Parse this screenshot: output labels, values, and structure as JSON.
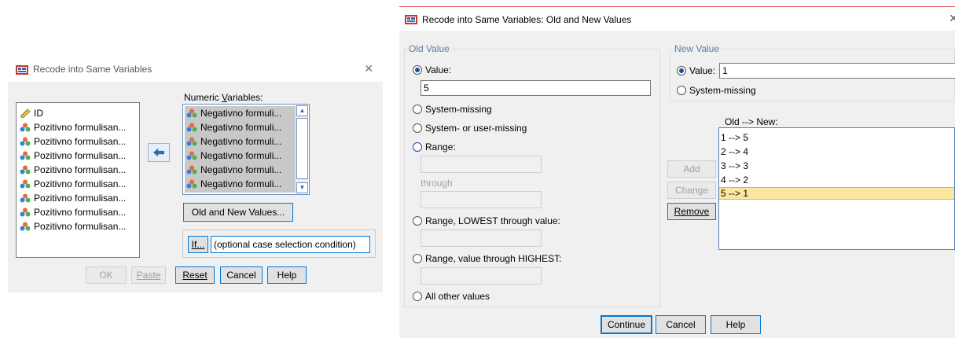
{
  "colors": {
    "dialog_bg": "#f0f0f0",
    "selected_item_bg": "#fbe7a1",
    "focus_border": "#0078d7",
    "group_label": "#5a7aa6"
  },
  "left_dialog": {
    "title": "Recode into Same Variables",
    "close_glyph": "✕",
    "source_list": {
      "items": [
        {
          "label": "ID",
          "icon": "ruler-icon"
        },
        {
          "label": "Pozitivno formulisan...",
          "icon": "nominal-variable-icon"
        },
        {
          "label": "Pozitivno formulisan...",
          "icon": "nominal-variable-icon"
        },
        {
          "label": "Pozitivno formulisan...",
          "icon": "nominal-variable-icon"
        },
        {
          "label": "Pozitivno formulisan...",
          "icon": "nominal-variable-icon"
        },
        {
          "label": "Pozitivno formulisan...",
          "icon": "nominal-variable-icon"
        },
        {
          "label": "Pozitivno formulisan...",
          "icon": "nominal-variable-icon"
        },
        {
          "label": "Pozitivno formulisan...",
          "icon": "nominal-variable-icon"
        },
        {
          "label": "Pozitivno formulisan...",
          "icon": "nominal-variable-icon"
        }
      ]
    },
    "move_arrow_icon": "arrow-left-icon",
    "numeric_variables_label_pre": "Numeric ",
    "numeric_variables_label_key": "V",
    "numeric_variables_label_post": "ariables:",
    "numeric_variables": {
      "items": [
        {
          "label": "Negativno formuli...",
          "icon": "nominal-variable-icon"
        },
        {
          "label": "Negativno formuli...",
          "icon": "nominal-variable-icon"
        },
        {
          "label": "Negativno formuli...",
          "icon": "nominal-variable-icon"
        },
        {
          "label": "Negativno formuli...",
          "icon": "nominal-variable-icon"
        },
        {
          "label": "Negativno formuli...",
          "icon": "nominal-variable-icon"
        },
        {
          "label": "Negativno formuli...",
          "icon": "nominal-variable-icon"
        }
      ]
    },
    "old_new_button": "Old and New Values...",
    "if_button": "If...",
    "if_condition": "(optional case selection condition)",
    "buttons": {
      "ok": "OK",
      "paste": "Paste",
      "reset": "Reset",
      "cancel": "Cancel",
      "help": "Help"
    }
  },
  "right_dialog": {
    "title": "Recode into Same Variables: Old and New Values",
    "close_glyph": "✕",
    "old_value": {
      "legend": "Old Value",
      "value_label": "Value:",
      "value_input": "5",
      "system_missing": "System-missing",
      "system_or_user_missing": "System- or user-missing",
      "range": "Range:",
      "through": "through",
      "range_lowest": "Range, LOWEST through value:",
      "range_highest": "Range, value through HIGHEST:",
      "all_other": "All other values"
    },
    "new_value": {
      "legend": "New Value",
      "value_label": "Value:",
      "value_input": "1",
      "system_missing": "System-missing"
    },
    "old_new_label": "Old --> New:",
    "mappings": [
      "1 --> 5",
      "2 --> 4",
      "3 --> 3",
      "4 --> 2",
      "5 --> 1"
    ],
    "selected_mapping_index": 4,
    "add_button": "Add",
    "change_button": "Change",
    "remove_button": "Remove",
    "continue_button": "Continue",
    "cancel_button": "Cancel",
    "help_button": "Help"
  }
}
